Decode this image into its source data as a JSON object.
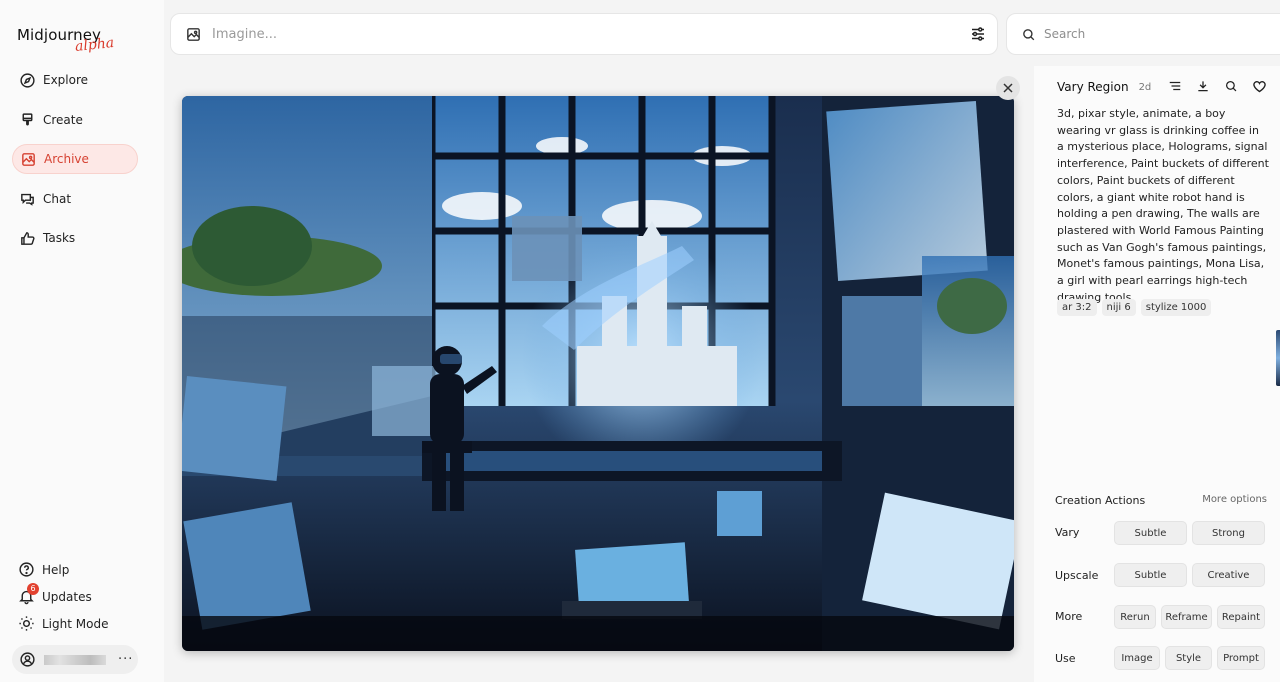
{
  "brand": {
    "name": "Midjourney",
    "tag": "alpha"
  },
  "nav": [
    {
      "label": "Explore",
      "icon": "compass-icon"
    },
    {
      "label": "Create",
      "icon": "brush-icon"
    },
    {
      "label": "Archive",
      "icon": "image-icon",
      "active": true
    },
    {
      "label": "Chat",
      "icon": "chat-icon"
    },
    {
      "label": "Tasks",
      "icon": "thumbs-up-icon"
    }
  ],
  "bottom_nav": {
    "help": "Help",
    "updates": "Updates",
    "updates_badge": "6",
    "light_mode": "Light Mode"
  },
  "user": {
    "more": "···"
  },
  "imagine": {
    "placeholder": "Imagine..."
  },
  "search": {
    "placeholder": "Search"
  },
  "detail": {
    "title": "Vary Region",
    "time": "2d",
    "prompt": "3d, pixar style, animate, a boy wearing vr glass is drinking coffee in a mysterious place, Holograms, signal interference, Paint buckets of different colors, Paint buckets of different colors, a giant white robot hand is holding a pen drawing, The walls are plastered with World Famous Painting such as Van Gogh's famous paintings, Monet's famous paintings, Mona Lisa, a girl with pearl earrings high-tech drawing tools",
    "tags": [
      "ar 3:2",
      "niji 6",
      "stylize 1000"
    ]
  },
  "actions": {
    "title": "Creation Actions",
    "more_options": "More options",
    "vary": {
      "label": "Vary",
      "buttons": [
        "Subtle",
        "Strong"
      ]
    },
    "upscale": {
      "label": "Upscale",
      "buttons": [
        "Subtle",
        "Creative"
      ]
    },
    "more": {
      "label": "More",
      "buttons": [
        "Rerun",
        "Reframe",
        "Repaint"
      ]
    },
    "use": {
      "label": "Use",
      "buttons": [
        "Image",
        "Style",
        "Prompt"
      ]
    }
  },
  "colors": {
    "accent": "#d64232",
    "active_bg": "#fde8e6"
  }
}
